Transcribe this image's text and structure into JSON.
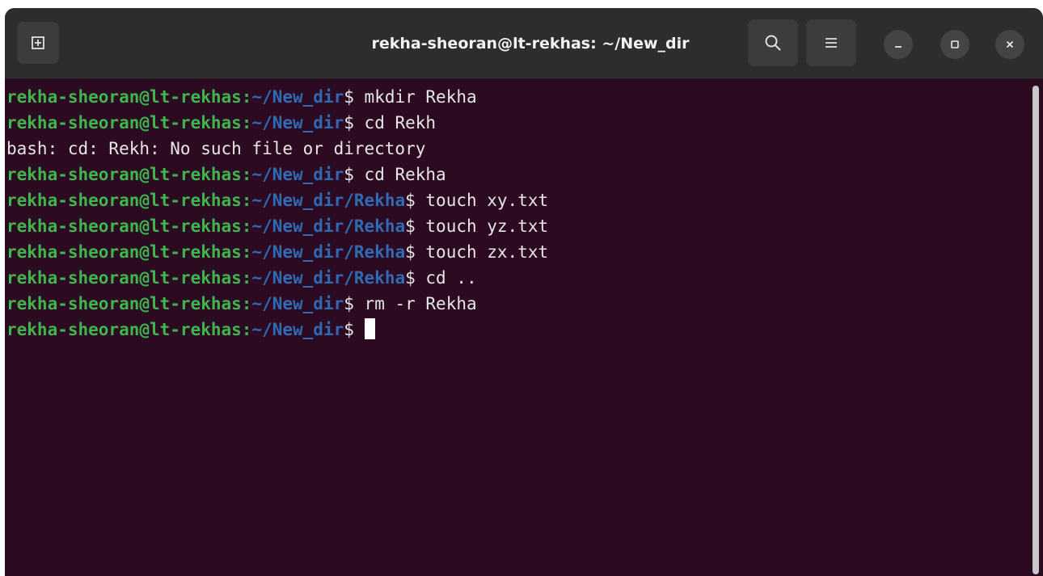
{
  "window": {
    "title": "rekha-sheoran@lt-rekhas: ~/New_dir"
  },
  "toolbar": {
    "new_tab_icon": "new-tab-icon",
    "search_icon": "search-icon",
    "menu_icon": "hamburger-menu-icon",
    "minimize_icon": "minimize-icon",
    "maximize_icon": "maximize-icon",
    "close_icon": "close-icon"
  },
  "terminal": {
    "lines": [
      {
        "kind": "prompt",
        "user": "rekha-sheoran@lt-rekhas",
        "sep": ":",
        "path": "~/New_dir",
        "dollar": "$",
        "cmd": " mkdir Rekha"
      },
      {
        "kind": "prompt",
        "user": "rekha-sheoran@lt-rekhas",
        "sep": ":",
        "path": "~/New_dir",
        "dollar": "$",
        "cmd": " cd Rekh"
      },
      {
        "kind": "output",
        "text": "bash: cd: Rekh: No such file or directory"
      },
      {
        "kind": "prompt",
        "user": "rekha-sheoran@lt-rekhas",
        "sep": ":",
        "path": "~/New_dir",
        "dollar": "$",
        "cmd": " cd Rekha"
      },
      {
        "kind": "prompt",
        "user": "rekha-sheoran@lt-rekhas",
        "sep": ":",
        "path": "~/New_dir/Rekha",
        "dollar": "$",
        "cmd": " touch xy.txt"
      },
      {
        "kind": "prompt",
        "user": "rekha-sheoran@lt-rekhas",
        "sep": ":",
        "path": "~/New_dir/Rekha",
        "dollar": "$",
        "cmd": " touch yz.txt"
      },
      {
        "kind": "prompt",
        "user": "rekha-sheoran@lt-rekhas",
        "sep": ":",
        "path": "~/New_dir/Rekha",
        "dollar": "$",
        "cmd": " touch zx.txt"
      },
      {
        "kind": "prompt",
        "user": "rekha-sheoran@lt-rekhas",
        "sep": ":",
        "path": "~/New_dir/Rekha",
        "dollar": "$",
        "cmd": " cd .."
      },
      {
        "kind": "prompt",
        "user": "rekha-sheoran@lt-rekhas",
        "sep": ":",
        "path": "~/New_dir",
        "dollar": "$",
        "cmd": " rm -r Rekha"
      },
      {
        "kind": "prompt",
        "user": "rekha-sheoran@lt-rekhas",
        "sep": ":",
        "path": "~/New_dir",
        "dollar": "$",
        "cmd": " ",
        "cursor": true
      }
    ]
  },
  "colors": {
    "background": "#2c0a22",
    "titlebar": "#2d2d2d",
    "prompt_user": "#3fb64d",
    "prompt_path": "#2f6bb5",
    "text": "#e6e6e6"
  }
}
